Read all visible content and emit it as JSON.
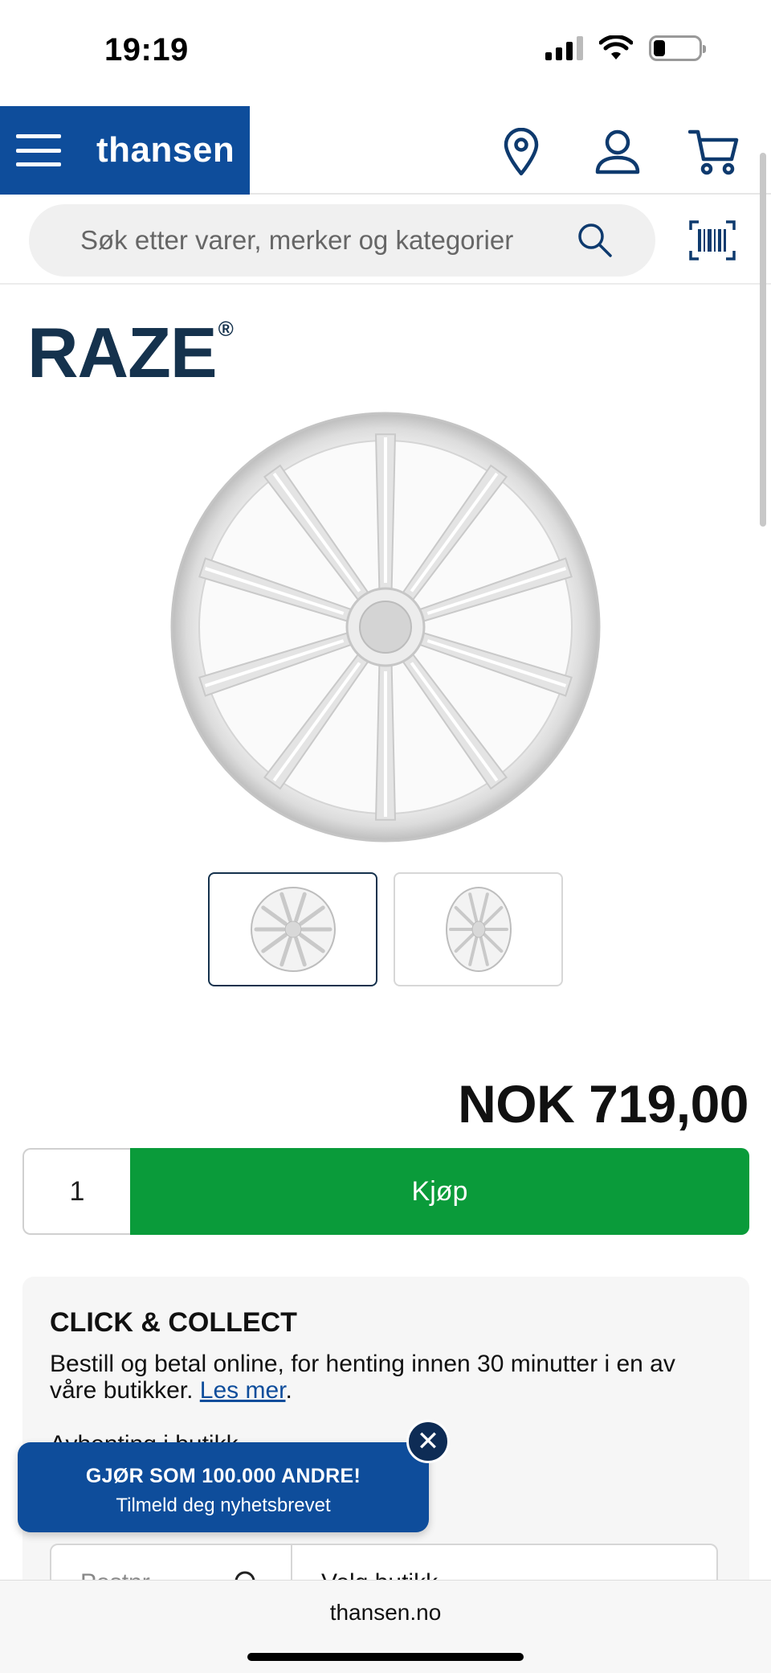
{
  "status_bar": {
    "time": "19:19"
  },
  "header": {
    "brand": "thansen",
    "icons": [
      "menu-icon",
      "location-pin-icon",
      "user-icon",
      "cart-icon"
    ],
    "brand_color": "#0e4d9b"
  },
  "search": {
    "placeholder": "Søk etter varer, merker og kategorier"
  },
  "product": {
    "brand_logo": "RAZE",
    "brand_logo_mark": "®",
    "price": "NOK 719,00",
    "quantity": "1",
    "buy_label": "Kjøp",
    "buy_color": "#0a9b3a",
    "thumbnails": [
      "hubcap-front",
      "hubcap-angle"
    ],
    "active_thumbnail": 0
  },
  "click_collect": {
    "title": "CLICK & COLLECT",
    "text": "Bestill og betal online, for henting innen 30 minutter i en av våre butikker.",
    "link": "Les mer",
    "link_suffix": ".",
    "sub": "Avhenting i butikk",
    "field1": "Postnr.",
    "field2": "Velg butikk"
  },
  "newsletter": {
    "title": "GJØR SOM 100.000 ANDRE!",
    "subtitle": "Tilmeld deg nyhetsbrevet",
    "close": "✕"
  },
  "browser": {
    "url": "thansen.no"
  }
}
